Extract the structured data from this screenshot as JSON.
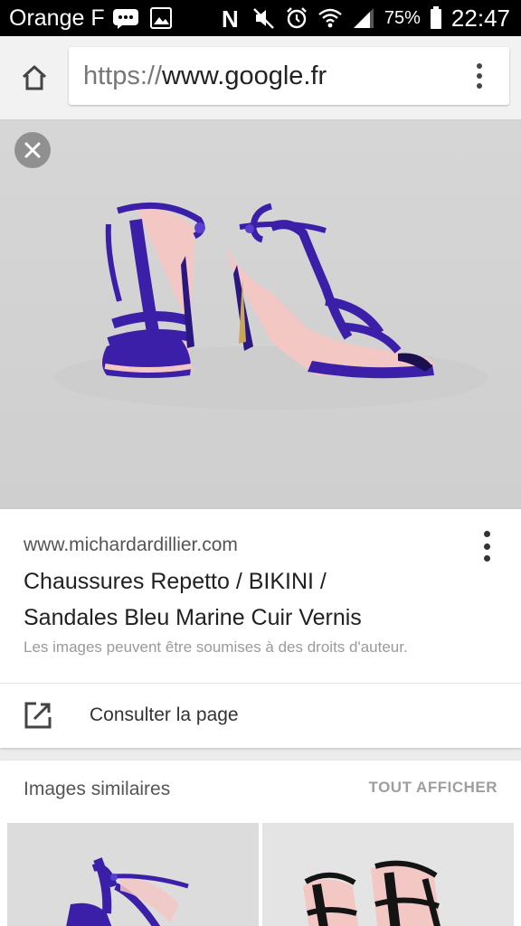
{
  "status_bar": {
    "carrier": "Orange F",
    "battery": "75%",
    "time": "22:47"
  },
  "browser": {
    "url_scheme": "https://",
    "url_host": "www.google.fr"
  },
  "result": {
    "domain": "www.michardardillier.com",
    "title_line1": "Chaussures Repetto / BIKINI /",
    "title_line2": "Sandales Bleu Marine Cuir Vernis",
    "copyright_notice": "Les images peuvent être soumises à des droits d'auteur.",
    "visit_label": "Consulter la page"
  },
  "similar": {
    "title": "Images similaires",
    "show_all": "TOUT AFFICHER"
  },
  "colors": {
    "sandal_blue": "#3b1fa8",
    "sandal_dark": "#1c0f66",
    "black_sandal": "#141414"
  }
}
